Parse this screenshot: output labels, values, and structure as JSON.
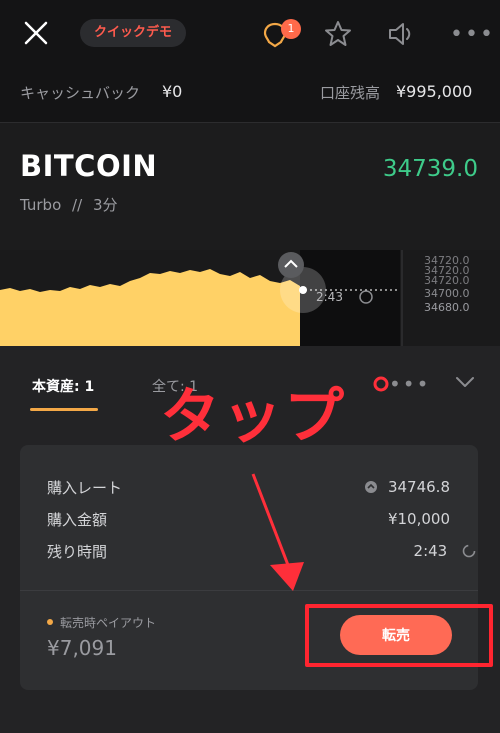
{
  "header": {
    "mode_badge": "クイックデモ",
    "notification_count": "1",
    "icons": [
      "close-icon",
      "bulb-icon",
      "star-icon",
      "speaker-icon",
      "more-icon"
    ]
  },
  "account": {
    "cashback_label": "キャッシュバック",
    "cashback_value": "¥0",
    "balance_label": "口座残高",
    "balance_value": "¥995,000"
  },
  "asset": {
    "name": "BITCOIN",
    "price": "34739.0",
    "type": "Turbo",
    "separator": "//",
    "duration": "3分"
  },
  "chart": {
    "countdown": "2:43",
    "price_ticks": [
      "34720.0",
      "34720.0",
      "34720.0",
      "34700.0",
      "34680.0"
    ],
    "colors": {
      "area": "#ffd166",
      "positive": "#3ecb8a"
    }
  },
  "tabs": {
    "current_asset": "本資産: 1",
    "all": "全て: 1"
  },
  "trade": {
    "rows": [
      {
        "label": "購入レート",
        "value": "34746.8"
      },
      {
        "label": "購入金額",
        "value": "¥10,000"
      },
      {
        "label": "残り時間",
        "value": "2:43"
      }
    ],
    "payout_label": "転売時ペイアウト",
    "payout_value": "¥7,091",
    "sell_label": "転売"
  },
  "annotation": {
    "tap_text": "タップ",
    "color": "#ff2f3a"
  }
}
